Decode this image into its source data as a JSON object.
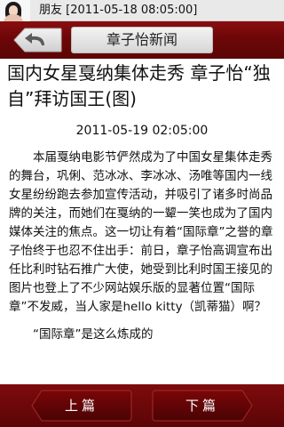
{
  "status": {
    "sender_label": "朋友 [2011-05-18 08:05:00]"
  },
  "header": {
    "title": "章子怡新闻"
  },
  "article": {
    "headline": "国内女星戛纳集体走秀 章子怡“独自”拜访国王(图)",
    "date": "2011-05-19 02:05:00",
    "paragraph": "本届戛纳电影节俨然成为了中国女星集体走秀的舞台，巩俐、范冰冰、李冰冰、汤唯等国内一线女星纷纷跑去参加宣传活动，并吸引了诸多时尚品牌的关注，而她们在戛纳的一颦一笑也成为了国内媒体关注的焦点。这一切让有着“国际章”之誉的章子怡终于也忍不住出手：前日，章子怡高调宣布出任比利时钻石推广大使，她受到比利时国王接见的图片也登上了不少网站娱乐版的显著位置“国际章”不发威，当人家是hello kitty（凯蒂猫）啊？",
    "subheading": "“国际章”是这么炼成的"
  },
  "nav": {
    "prev_label": "上篇",
    "next_label": "下篇"
  },
  "colors": {
    "header_red": "#6d0608",
    "pill_bg": "#e6e6e6"
  }
}
